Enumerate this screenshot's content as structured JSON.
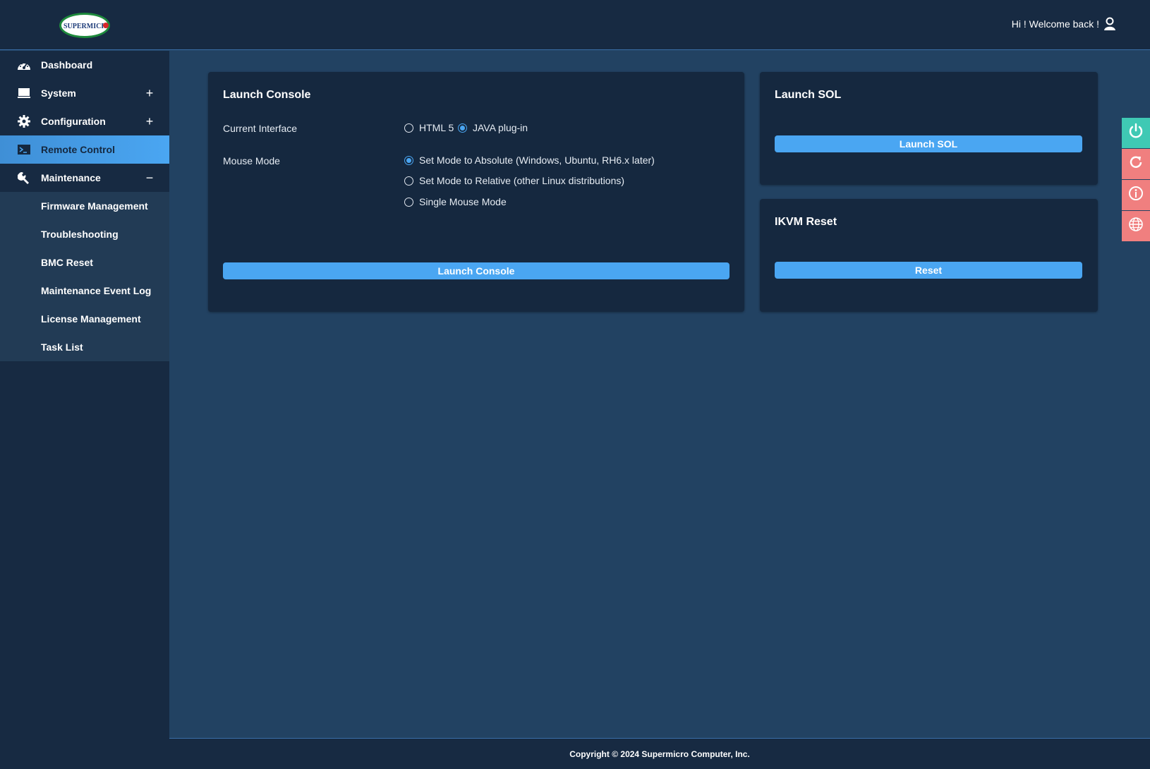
{
  "header": {
    "logo_text": "SUPERMICRO",
    "welcome": "Hi ! Welcome back !"
  },
  "sidebar": {
    "items": [
      {
        "label": "Dashboard",
        "icon": "dashboard-gauge-icon",
        "toggle": ""
      },
      {
        "label": "System",
        "icon": "monitor-icon",
        "toggle": "+"
      },
      {
        "label": "Configuration",
        "icon": "gear-icon",
        "toggle": "+"
      },
      {
        "label": "Remote Control",
        "icon": "terminal-icon",
        "toggle": "",
        "active": true
      },
      {
        "label": "Maintenance",
        "icon": "wrench-icon",
        "toggle": "−"
      }
    ],
    "maintenance_sub": [
      {
        "label": "Firmware Management"
      },
      {
        "label": "Troubleshooting"
      },
      {
        "label": "BMC Reset"
      },
      {
        "label": "Maintenance Event Log"
      },
      {
        "label": "License Management"
      },
      {
        "label": "Task List"
      }
    ]
  },
  "launch_console": {
    "title": "Launch Console",
    "interface_label": "Current Interface",
    "interface_options": [
      {
        "label": "HTML 5",
        "checked": false
      },
      {
        "label": "JAVA plug-in",
        "checked": true
      }
    ],
    "mouse_label": "Mouse Mode",
    "mouse_options": [
      {
        "label": "Set Mode to Absolute (Windows, Ubuntu, RH6.x later)",
        "checked": true
      },
      {
        "label": "Set Mode to Relative (other Linux distributions)",
        "checked": false
      },
      {
        "label": "Single Mouse Mode",
        "checked": false
      }
    ],
    "button": "Launch Console"
  },
  "launch_sol": {
    "title": "Launch SOL",
    "button": "Launch SOL"
  },
  "ikvm_reset": {
    "title": "IKVM Reset",
    "button": "Reset"
  },
  "quick_actions": [
    {
      "icon": "power-icon",
      "color": "#3fc9b4"
    },
    {
      "icon": "refresh-icon",
      "color": "#f07f7f"
    },
    {
      "icon": "info-icon",
      "color": "#f07f7f"
    },
    {
      "icon": "globe-icon",
      "color": "#f07f7f"
    }
  ],
  "colors": {
    "accent": "#4aa6f2",
    "panel": "#15283f",
    "background": "#224262"
  },
  "footer": {
    "copyright": "Copyright © 2024 Supermicro Computer, Inc."
  }
}
